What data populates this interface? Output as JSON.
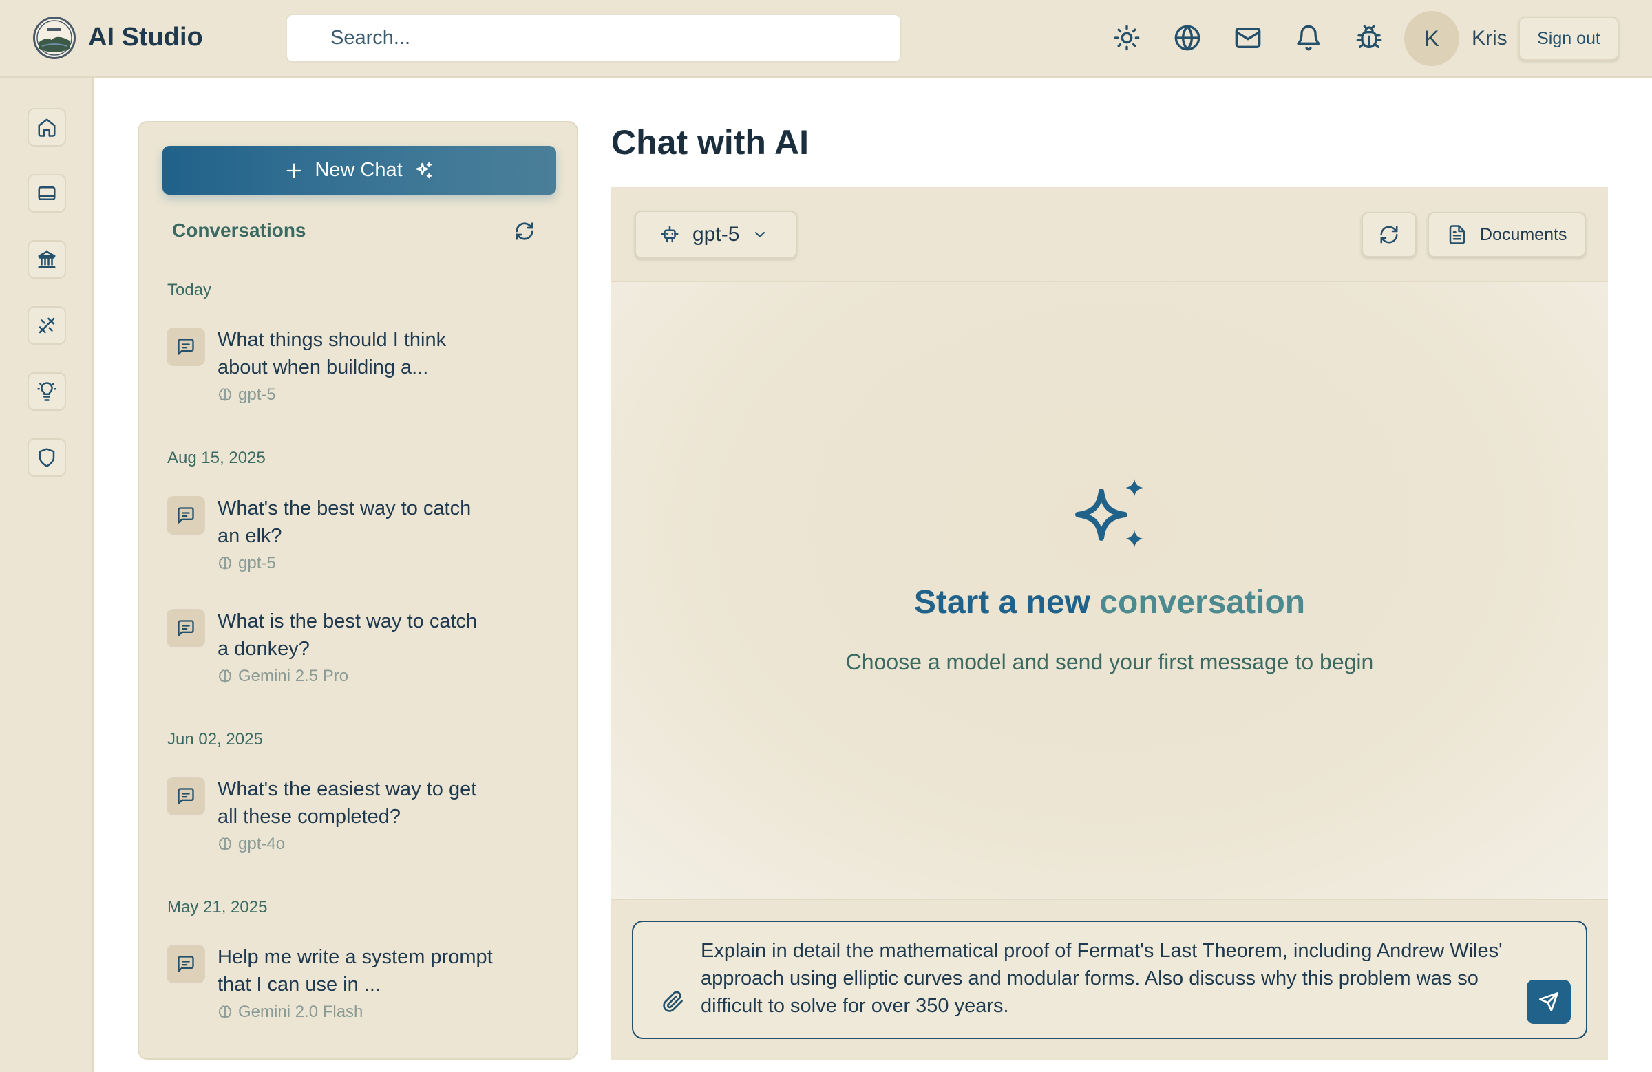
{
  "header": {
    "app_title": "AI Studio",
    "search_placeholder": "Search...",
    "user_initial": "K",
    "user_name": "Kris",
    "signout_label": "Sign out",
    "icons": [
      "sun-icon",
      "globe-icon",
      "mail-icon",
      "bell-icon",
      "bug-icon"
    ]
  },
  "rail": {
    "icons": [
      "home-icon",
      "tablet-icon",
      "bank-icon",
      "tools-icon",
      "lightbulb-icon",
      "shield-icon"
    ]
  },
  "sidebar": {
    "new_chat_label": "New Chat",
    "conversations_heading": "Conversations",
    "groups": [
      {
        "date": "Today",
        "items": [
          {
            "title": "What things should I think about when building a...",
            "model": "gpt-5"
          }
        ]
      },
      {
        "date": "Aug 15, 2025",
        "items": [
          {
            "title": "What's the best way to catch an elk?",
            "model": "gpt-5"
          },
          {
            "title": "What is the best way to catch a donkey?",
            "model": "Gemini 2.5 Pro"
          }
        ]
      },
      {
        "date": "Jun 02, 2025",
        "items": [
          {
            "title": "What's the easiest way to get all these completed?",
            "model": "gpt-4o"
          }
        ]
      },
      {
        "date": "May 21, 2025",
        "items": [
          {
            "title": "Help me write a system prompt that I can use in ...",
            "model": "Gemini 2.0 Flash"
          }
        ]
      }
    ]
  },
  "main": {
    "title": "Chat with AI",
    "model_selected": "gpt-5",
    "documents_label": "Documents",
    "empty_title_part1": "Start a new ",
    "empty_title_part2": "conversation",
    "empty_subtitle": "Choose a model and send your first message to begin",
    "composer_value": "Explain in detail the mathematical proof of Fermat's Last Theorem, including Andrew Wiles' approach using elliptic curves and modular forms. Also discuss why this problem was so difficult to solve for over 350 years."
  },
  "colors": {
    "accent": "#21628a",
    "background": "#ece5d3",
    "text": "#1f3a4f"
  }
}
